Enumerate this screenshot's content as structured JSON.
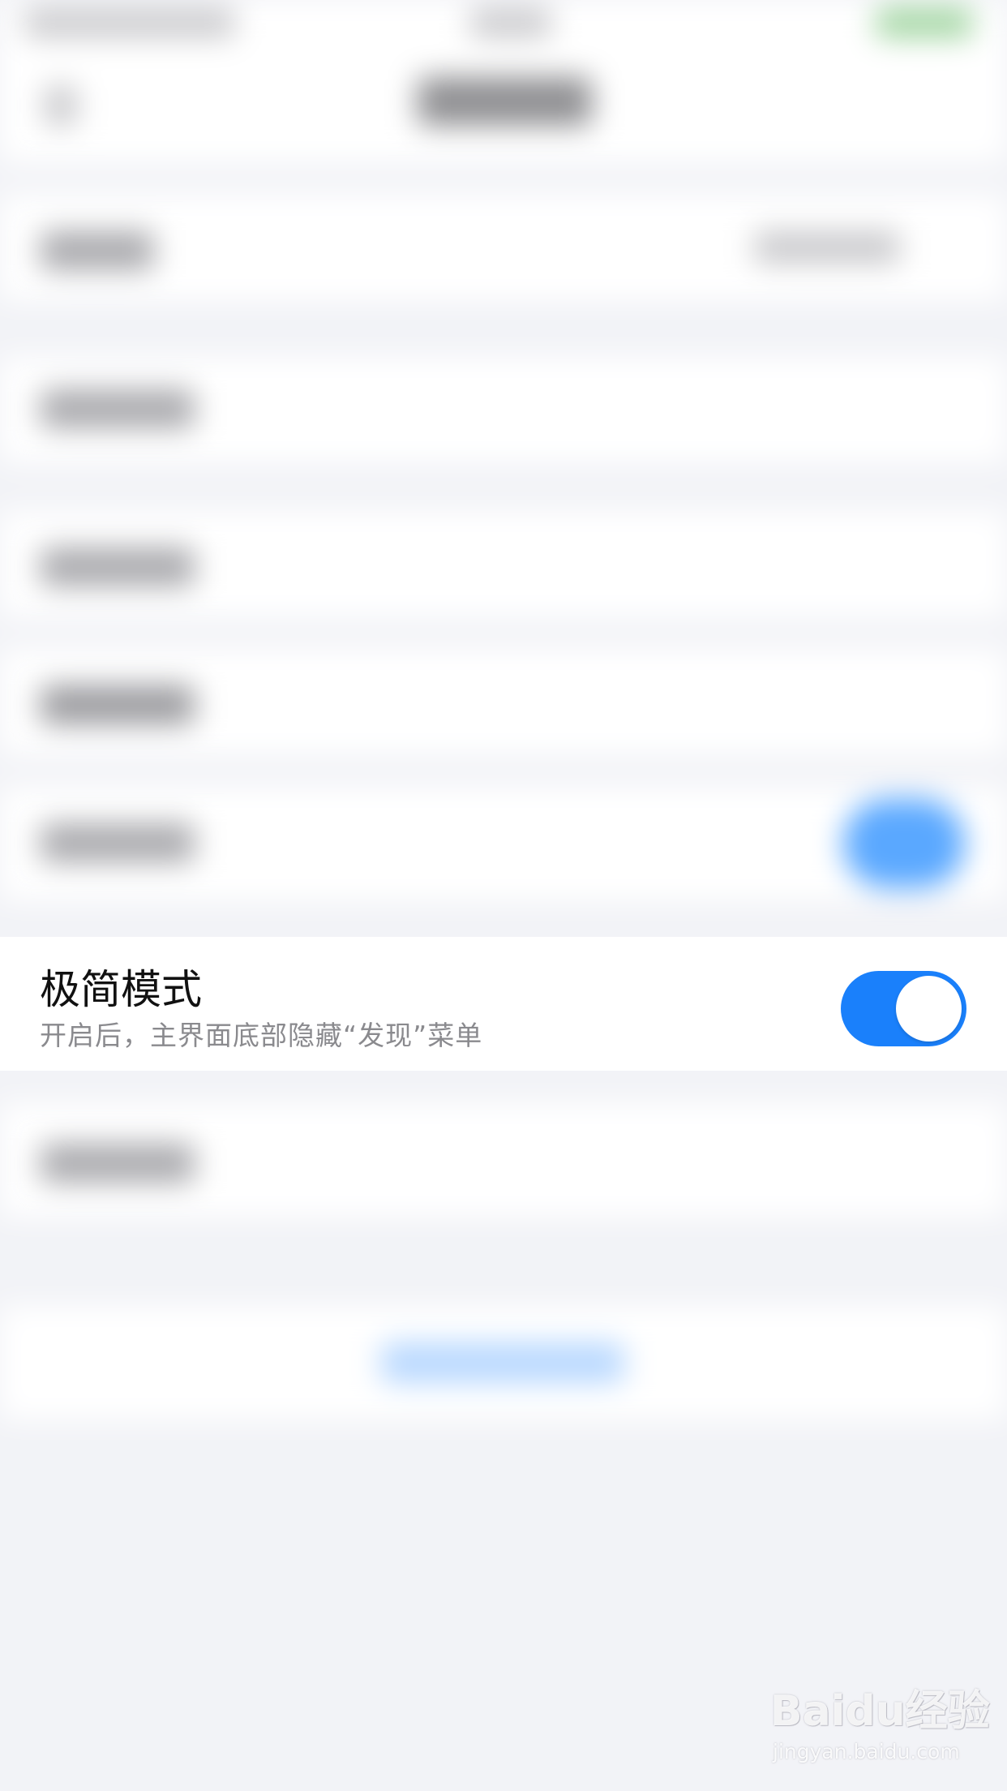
{
  "setting": {
    "title": "极简模式",
    "description": "开启后，主界面底部隐藏“发现”菜单",
    "toggle_state": "on"
  },
  "watermark": {
    "logo_text": "Baidu经验",
    "url": "jingyan.baidu.com"
  },
  "colors": {
    "accent": "#1a80fb",
    "background": "#f2f3f7"
  }
}
